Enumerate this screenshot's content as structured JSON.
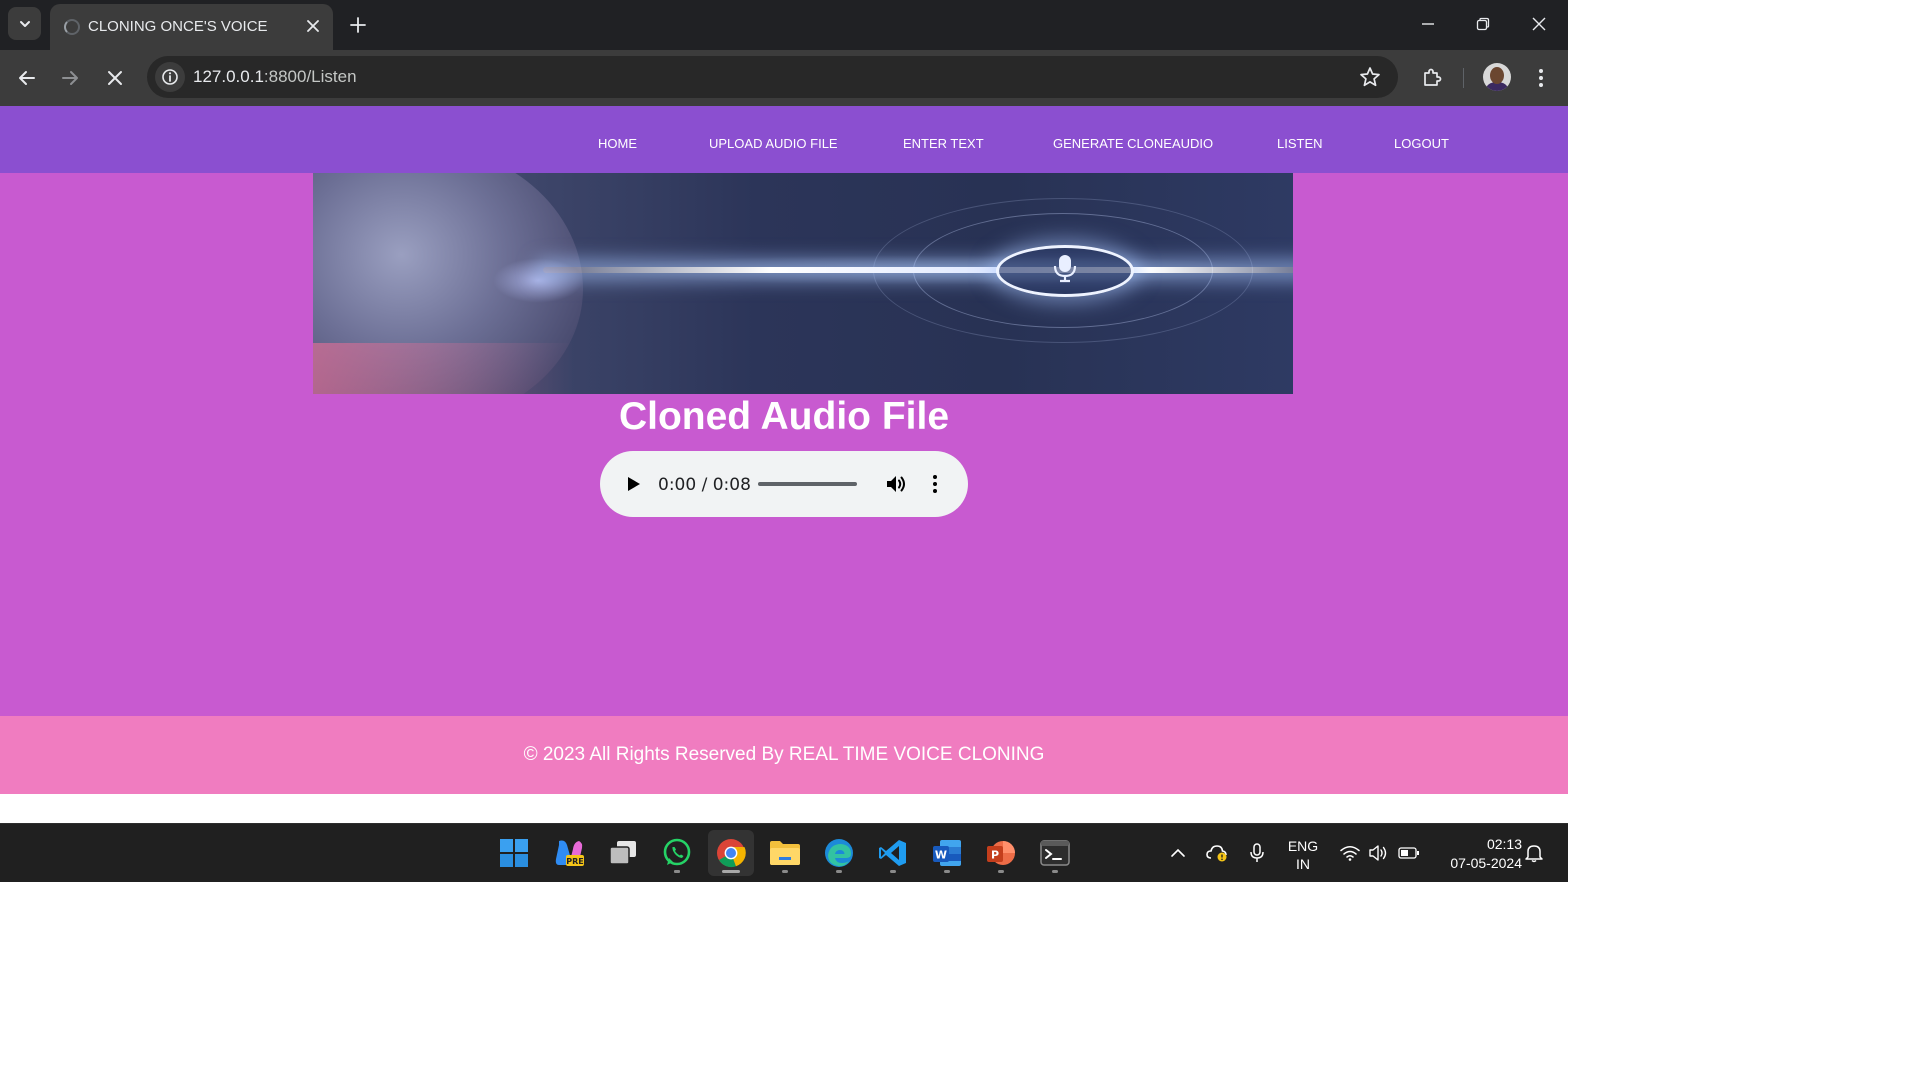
{
  "browser": {
    "tab_title": "CLONING ONCE'S VOICE",
    "url_host": "127.0.0.1",
    "url_path": ":8800/Listen"
  },
  "nav": {
    "items": [
      "HOME",
      "UPLOAD AUDIO FILE",
      "ENTER TEXT",
      "GENERATE CLONEAUDIO",
      "LISTEN",
      "LOGOUT"
    ]
  },
  "banner": {
    "icon": "voice-wave-banner-image"
  },
  "main": {
    "heading": "Cloned Audio File",
    "audio": {
      "time": "0:00 / 0:08",
      "progress": 0
    }
  },
  "footer": {
    "text": "© 2023 All Rights Reserved By REAL TIME VOICE CLONING"
  },
  "taskbar": {
    "apps": [
      "windows-start",
      "copilot-pre",
      "task-view",
      "whatsapp",
      "chrome",
      "file-explorer",
      "edge",
      "vscode",
      "word",
      "powerpoint",
      "terminal"
    ],
    "lang_top": "ENG",
    "lang_bottom": "IN",
    "time": "02:13",
    "date": "07-05-2024"
  },
  "colors": {
    "navbar": "#8b4fd0",
    "main": "#c85ad0",
    "footer": "#f07cc0"
  }
}
